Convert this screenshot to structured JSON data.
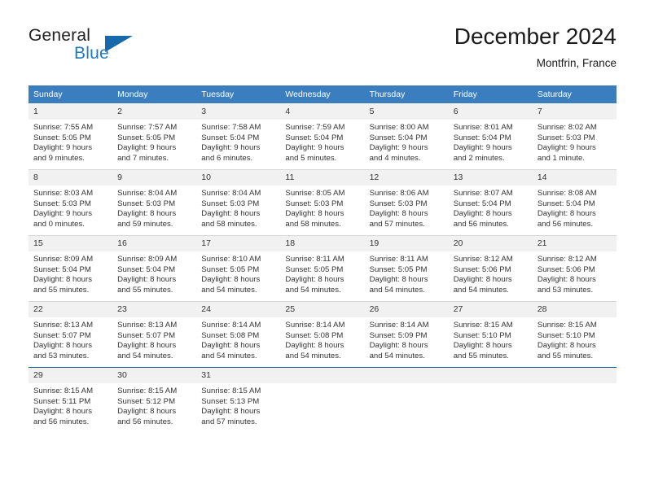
{
  "brand": {
    "name_part1": "General",
    "name_part2": "Blue",
    "logo_icon": "blue-triangle-icon",
    "accent_color": "#1f7ac4",
    "triangle_color": "#1769ab"
  },
  "header": {
    "title": "December 2024",
    "subtitle": "Montfrin, France"
  },
  "calendar": {
    "header_bg": "#3a7ebf",
    "header_text_color": "#ffffff",
    "daynum_bg": "#f1f1f1",
    "weekday_headers": [
      "Sunday",
      "Monday",
      "Tuesday",
      "Wednesday",
      "Thursday",
      "Friday",
      "Saturday"
    ],
    "weeks": [
      [
        {
          "day": "1",
          "sunrise": "Sunrise: 7:55 AM",
          "sunset": "Sunset: 5:05 PM",
          "daylight_line1": "Daylight: 9 hours",
          "daylight_line2": "and 9 minutes."
        },
        {
          "day": "2",
          "sunrise": "Sunrise: 7:57 AM",
          "sunset": "Sunset: 5:05 PM",
          "daylight_line1": "Daylight: 9 hours",
          "daylight_line2": "and 7 minutes."
        },
        {
          "day": "3",
          "sunrise": "Sunrise: 7:58 AM",
          "sunset": "Sunset: 5:04 PM",
          "daylight_line1": "Daylight: 9 hours",
          "daylight_line2": "and 6 minutes."
        },
        {
          "day": "4",
          "sunrise": "Sunrise: 7:59 AM",
          "sunset": "Sunset: 5:04 PM",
          "daylight_line1": "Daylight: 9 hours",
          "daylight_line2": "and 5 minutes."
        },
        {
          "day": "5",
          "sunrise": "Sunrise: 8:00 AM",
          "sunset": "Sunset: 5:04 PM",
          "daylight_line1": "Daylight: 9 hours",
          "daylight_line2": "and 4 minutes."
        },
        {
          "day": "6",
          "sunrise": "Sunrise: 8:01 AM",
          "sunset": "Sunset: 5:04 PM",
          "daylight_line1": "Daylight: 9 hours",
          "daylight_line2": "and 2 minutes."
        },
        {
          "day": "7",
          "sunrise": "Sunrise: 8:02 AM",
          "sunset": "Sunset: 5:03 PM",
          "daylight_line1": "Daylight: 9 hours",
          "daylight_line2": "and 1 minute."
        }
      ],
      [
        {
          "day": "8",
          "sunrise": "Sunrise: 8:03 AM",
          "sunset": "Sunset: 5:03 PM",
          "daylight_line1": "Daylight: 9 hours",
          "daylight_line2": "and 0 minutes."
        },
        {
          "day": "9",
          "sunrise": "Sunrise: 8:04 AM",
          "sunset": "Sunset: 5:03 PM",
          "daylight_line1": "Daylight: 8 hours",
          "daylight_line2": "and 59 minutes."
        },
        {
          "day": "10",
          "sunrise": "Sunrise: 8:04 AM",
          "sunset": "Sunset: 5:03 PM",
          "daylight_line1": "Daylight: 8 hours",
          "daylight_line2": "and 58 minutes."
        },
        {
          "day": "11",
          "sunrise": "Sunrise: 8:05 AM",
          "sunset": "Sunset: 5:03 PM",
          "daylight_line1": "Daylight: 8 hours",
          "daylight_line2": "and 58 minutes."
        },
        {
          "day": "12",
          "sunrise": "Sunrise: 8:06 AM",
          "sunset": "Sunset: 5:03 PM",
          "daylight_line1": "Daylight: 8 hours",
          "daylight_line2": "and 57 minutes."
        },
        {
          "day": "13",
          "sunrise": "Sunrise: 8:07 AM",
          "sunset": "Sunset: 5:04 PM",
          "daylight_line1": "Daylight: 8 hours",
          "daylight_line2": "and 56 minutes."
        },
        {
          "day": "14",
          "sunrise": "Sunrise: 8:08 AM",
          "sunset": "Sunset: 5:04 PM",
          "daylight_line1": "Daylight: 8 hours",
          "daylight_line2": "and 56 minutes."
        }
      ],
      [
        {
          "day": "15",
          "sunrise": "Sunrise: 8:09 AM",
          "sunset": "Sunset: 5:04 PM",
          "daylight_line1": "Daylight: 8 hours",
          "daylight_line2": "and 55 minutes."
        },
        {
          "day": "16",
          "sunrise": "Sunrise: 8:09 AM",
          "sunset": "Sunset: 5:04 PM",
          "daylight_line1": "Daylight: 8 hours",
          "daylight_line2": "and 55 minutes."
        },
        {
          "day": "17",
          "sunrise": "Sunrise: 8:10 AM",
          "sunset": "Sunset: 5:05 PM",
          "daylight_line1": "Daylight: 8 hours",
          "daylight_line2": "and 54 minutes."
        },
        {
          "day": "18",
          "sunrise": "Sunrise: 8:11 AM",
          "sunset": "Sunset: 5:05 PM",
          "daylight_line1": "Daylight: 8 hours",
          "daylight_line2": "and 54 minutes."
        },
        {
          "day": "19",
          "sunrise": "Sunrise: 8:11 AM",
          "sunset": "Sunset: 5:05 PM",
          "daylight_line1": "Daylight: 8 hours",
          "daylight_line2": "and 54 minutes."
        },
        {
          "day": "20",
          "sunrise": "Sunrise: 8:12 AM",
          "sunset": "Sunset: 5:06 PM",
          "daylight_line1": "Daylight: 8 hours",
          "daylight_line2": "and 54 minutes."
        },
        {
          "day": "21",
          "sunrise": "Sunrise: 8:12 AM",
          "sunset": "Sunset: 5:06 PM",
          "daylight_line1": "Daylight: 8 hours",
          "daylight_line2": "and 53 minutes."
        }
      ],
      [
        {
          "day": "22",
          "sunrise": "Sunrise: 8:13 AM",
          "sunset": "Sunset: 5:07 PM",
          "daylight_line1": "Daylight: 8 hours",
          "daylight_line2": "and 53 minutes."
        },
        {
          "day": "23",
          "sunrise": "Sunrise: 8:13 AM",
          "sunset": "Sunset: 5:07 PM",
          "daylight_line1": "Daylight: 8 hours",
          "daylight_line2": "and 54 minutes."
        },
        {
          "day": "24",
          "sunrise": "Sunrise: 8:14 AM",
          "sunset": "Sunset: 5:08 PM",
          "daylight_line1": "Daylight: 8 hours",
          "daylight_line2": "and 54 minutes."
        },
        {
          "day": "25",
          "sunrise": "Sunrise: 8:14 AM",
          "sunset": "Sunset: 5:08 PM",
          "daylight_line1": "Daylight: 8 hours",
          "daylight_line2": "and 54 minutes."
        },
        {
          "day": "26",
          "sunrise": "Sunrise: 8:14 AM",
          "sunset": "Sunset: 5:09 PM",
          "daylight_line1": "Daylight: 8 hours",
          "daylight_line2": "and 54 minutes."
        },
        {
          "day": "27",
          "sunrise": "Sunrise: 8:15 AM",
          "sunset": "Sunset: 5:10 PM",
          "daylight_line1": "Daylight: 8 hours",
          "daylight_line2": "and 55 minutes."
        },
        {
          "day": "28",
          "sunrise": "Sunrise: 8:15 AM",
          "sunset": "Sunset: 5:10 PM",
          "daylight_line1": "Daylight: 8 hours",
          "daylight_line2": "and 55 minutes."
        }
      ],
      [
        {
          "day": "29",
          "sunrise": "Sunrise: 8:15 AM",
          "sunset": "Sunset: 5:11 PM",
          "daylight_line1": "Daylight: 8 hours",
          "daylight_line2": "and 56 minutes."
        },
        {
          "day": "30",
          "sunrise": "Sunrise: 8:15 AM",
          "sunset": "Sunset: 5:12 PM",
          "daylight_line1": "Daylight: 8 hours",
          "daylight_line2": "and 56 minutes."
        },
        {
          "day": "31",
          "sunrise": "Sunrise: 8:15 AM",
          "sunset": "Sunset: 5:13 PM",
          "daylight_line1": "Daylight: 8 hours",
          "daylight_line2": "and 57 minutes."
        },
        {
          "day": "",
          "sunrise": "",
          "sunset": "",
          "daylight_line1": "",
          "daylight_line2": ""
        },
        {
          "day": "",
          "sunrise": "",
          "sunset": "",
          "daylight_line1": "",
          "daylight_line2": ""
        },
        {
          "day": "",
          "sunrise": "",
          "sunset": "",
          "daylight_line1": "",
          "daylight_line2": ""
        },
        {
          "day": "",
          "sunrise": "",
          "sunset": "",
          "daylight_line1": "",
          "daylight_line2": ""
        }
      ]
    ]
  }
}
